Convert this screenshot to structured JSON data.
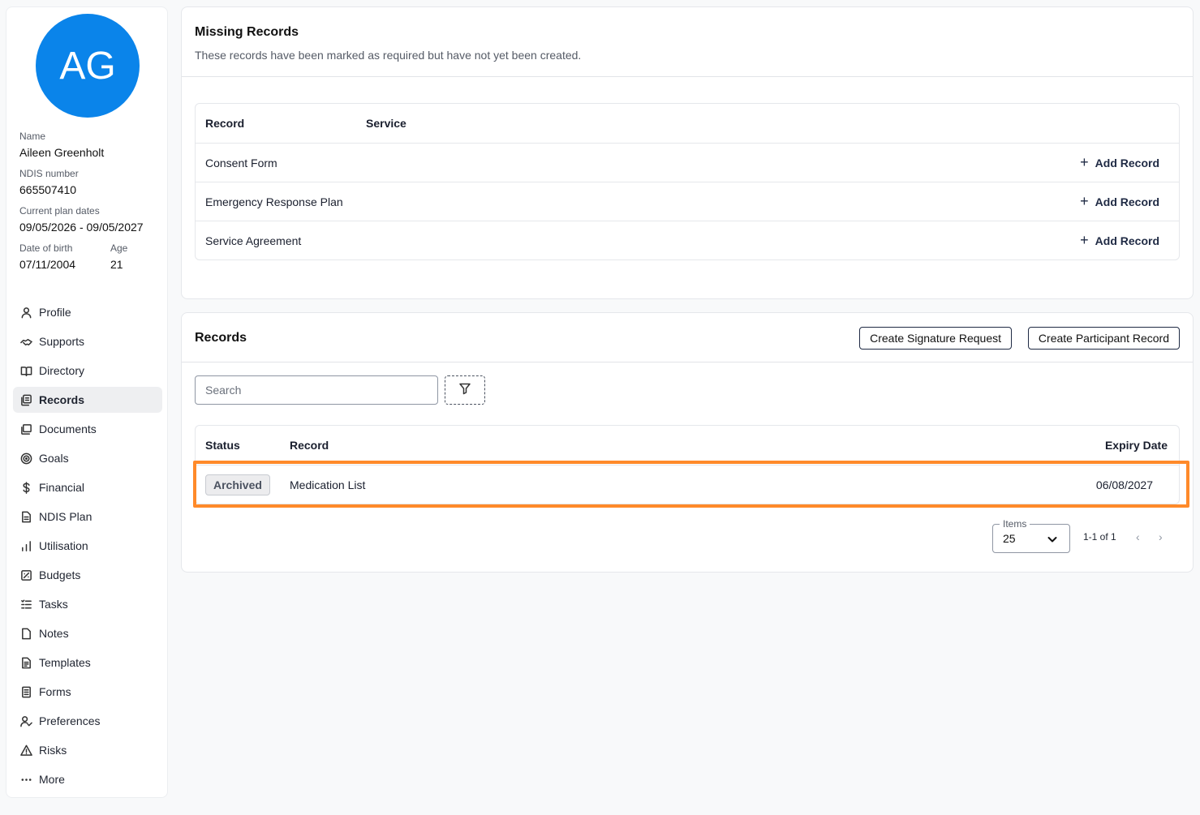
{
  "profile": {
    "initials": "AG",
    "name_label": "Name",
    "name": "Aileen Greenholt",
    "ndis_label": "NDIS number",
    "ndis": "665507410",
    "plan_label": "Current plan dates",
    "plan_dates": "09/05/2026 - 09/05/2027",
    "dob_label": "Date of birth",
    "dob": "07/11/2004",
    "age_label": "Age",
    "age": "21"
  },
  "nav": [
    {
      "label": "Profile",
      "icon": "user-icon"
    },
    {
      "label": "Supports",
      "icon": "handshake-icon"
    },
    {
      "label": "Directory",
      "icon": "book-icon"
    },
    {
      "label": "Records",
      "icon": "records-icon",
      "active": true
    },
    {
      "label": "Documents",
      "icon": "documents-icon"
    },
    {
      "label": "Goals",
      "icon": "target-icon"
    },
    {
      "label": "Financial",
      "icon": "dollar-icon"
    },
    {
      "label": "NDIS Plan",
      "icon": "file-icon"
    },
    {
      "label": "Utilisation",
      "icon": "bar-chart-icon"
    },
    {
      "label": "Budgets",
      "icon": "budget-icon"
    },
    {
      "label": "Tasks",
      "icon": "tasks-icon"
    },
    {
      "label": "Notes",
      "icon": "note-icon"
    },
    {
      "label": "Templates",
      "icon": "template-icon"
    },
    {
      "label": "Forms",
      "icon": "form-icon"
    },
    {
      "label": "Preferences",
      "icon": "user-check-icon"
    },
    {
      "label": "Risks",
      "icon": "warning-icon"
    },
    {
      "label": "More",
      "icon": "ellipsis-icon"
    }
  ],
  "missing": {
    "title": "Missing Records",
    "subtitle": "These records have been marked as required but have not yet been created.",
    "col_record": "Record",
    "col_service": "Service",
    "add_label": "Add Record",
    "rows": [
      "Consent Form",
      "Emergency Response Plan",
      "Service Agreement"
    ]
  },
  "records": {
    "title": "Records",
    "btn_signature": "Create Signature Request",
    "btn_participant": "Create Participant Record",
    "search_placeholder": "Search",
    "col_status": "Status",
    "col_record": "Record",
    "col_expiry": "Expiry Date",
    "rows": [
      {
        "status": "Archived",
        "record": "Medication List",
        "expiry": "06/08/2027"
      }
    ],
    "items_label": "Items",
    "items_value": "25",
    "pager_text": "1-1 of 1"
  }
}
